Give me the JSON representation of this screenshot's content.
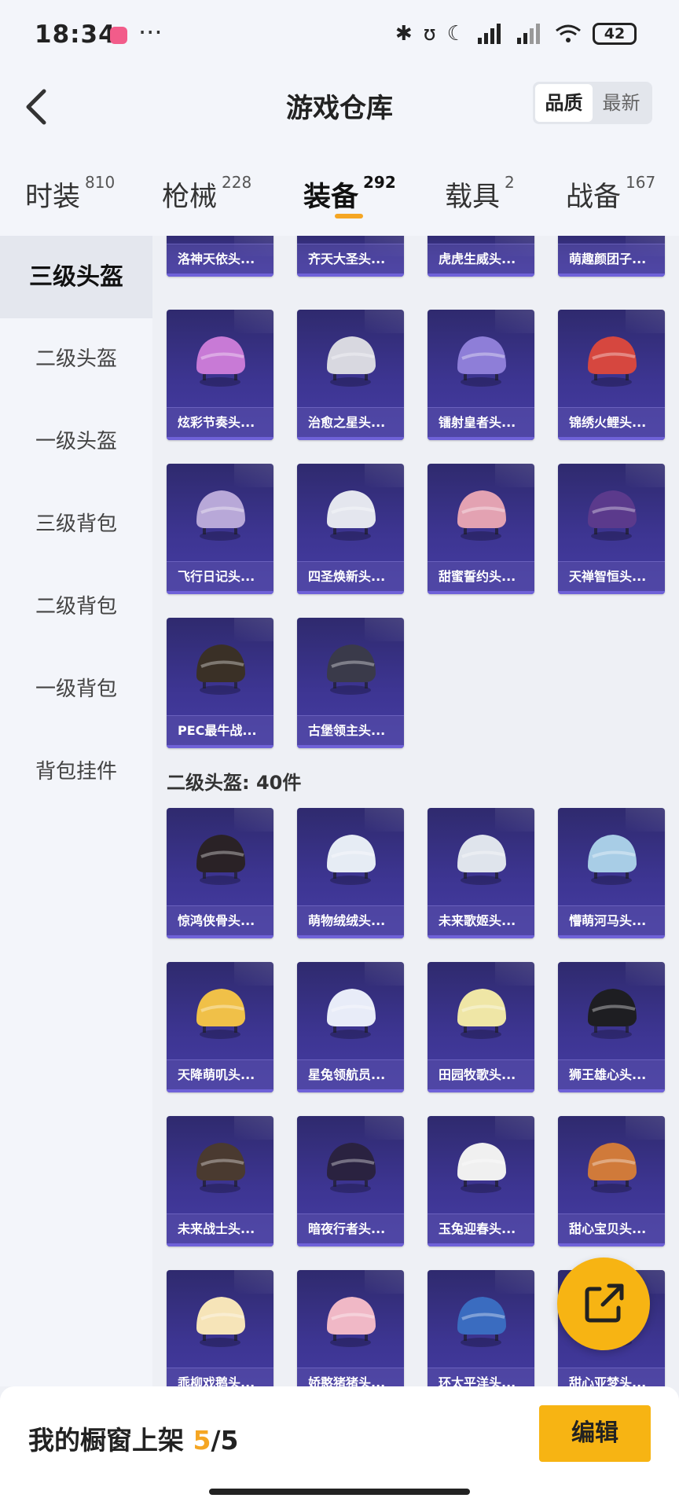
{
  "status_bar": {
    "time": "18:34",
    "more": "···",
    "battery": "42"
  },
  "header": {
    "title": "游戏仓库",
    "sort_options": [
      "品质",
      "最新"
    ],
    "sort_active": "品质"
  },
  "tabs": [
    {
      "label": "时装",
      "count": "810"
    },
    {
      "label": "枪械",
      "count": "228"
    },
    {
      "label": "装备",
      "count": "292",
      "active": true
    },
    {
      "label": "载具",
      "count": "2"
    },
    {
      "label": "战备",
      "count": "167"
    }
  ],
  "sidebar": [
    {
      "label": "三级头盔",
      "active": true
    },
    {
      "label": "二级头盔"
    },
    {
      "label": "一级头盔"
    },
    {
      "label": "三级背包"
    },
    {
      "label": "二级背包"
    },
    {
      "label": "一级背包"
    },
    {
      "label": "背包挂件"
    }
  ],
  "section_2_title": "二级头盔: 40件",
  "items_level3": [
    "洛神天依头...",
    "齐天大圣头...",
    "虎虎生威头...",
    "萌趣颜团子...",
    "炫彩节奏头...",
    "治愈之星头...",
    "镭射皇者头...",
    "锦绣火鲤头...",
    "飞行日记头...",
    "四圣焕新头...",
    "甜蜜誓约头...",
    "天禅智恒头...",
    "PEC最牛战...",
    "古堡领主头..."
  ],
  "items_level2": [
    "惊鸿侠骨头...",
    "萌物绒绒头...",
    "未来歌姬头...",
    "懵萌河马头...",
    "天降萌叽头...",
    "星兔领航员...",
    "田园牧歌头...",
    "狮王雄心头...",
    "未来战士头...",
    "暗夜行者头...",
    "玉兔迎春头...",
    "甜心宝贝头...",
    "乖柳戏鹅头...",
    "娇憨猪猪头...",
    "环太平洋头...",
    "甜心亚梦头..."
  ],
  "helmet_colors_level3": [
    "#d9d9e6",
    "#b07a3a",
    "#2a2228",
    "#6a8b3a",
    "#c87ad6",
    "#d8d8e0",
    "#8e7ed8",
    "#d6473f",
    "#b8a8d8",
    "#e4e6ee",
    "#e3a2b2",
    "#5b3a8c",
    "#3a3026",
    "#3a3a4a"
  ],
  "helmet_colors_level2": [
    "#2a2226",
    "#e6ecf4",
    "#dfe4ec",
    "#a8cde6",
    "#f0c048",
    "#e8ecf8",
    "#efe6a6",
    "#1e1e22",
    "#4a3a30",
    "#2a2240",
    "#f0f0f0",
    "#d07a3a",
    "#f6e4b8",
    "#f0b8c6",
    "#3a6cc0",
    "#e8e8ec"
  ],
  "bottom_bar": {
    "label": "我的橱窗上架",
    "count": "5",
    "total": "/5",
    "edit_label": "编辑"
  }
}
